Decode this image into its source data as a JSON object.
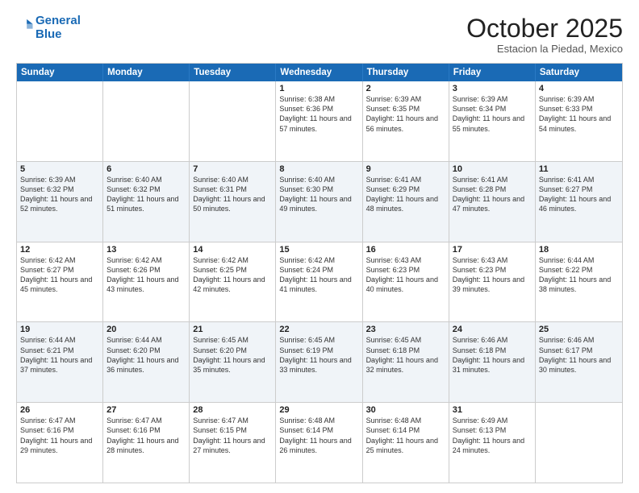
{
  "header": {
    "logo_line1": "General",
    "logo_line2": "Blue",
    "month": "October 2025",
    "location": "Estacion la Piedad, Mexico"
  },
  "days_of_week": [
    "Sunday",
    "Monday",
    "Tuesday",
    "Wednesday",
    "Thursday",
    "Friday",
    "Saturday"
  ],
  "weeks": [
    {
      "alt": false,
      "cells": [
        {
          "day": "",
          "text": ""
        },
        {
          "day": "",
          "text": ""
        },
        {
          "day": "",
          "text": ""
        },
        {
          "day": "1",
          "text": "Sunrise: 6:38 AM\nSunset: 6:36 PM\nDaylight: 11 hours and 57 minutes."
        },
        {
          "day": "2",
          "text": "Sunrise: 6:39 AM\nSunset: 6:35 PM\nDaylight: 11 hours and 56 minutes."
        },
        {
          "day": "3",
          "text": "Sunrise: 6:39 AM\nSunset: 6:34 PM\nDaylight: 11 hours and 55 minutes."
        },
        {
          "day": "4",
          "text": "Sunrise: 6:39 AM\nSunset: 6:33 PM\nDaylight: 11 hours and 54 minutes."
        }
      ]
    },
    {
      "alt": true,
      "cells": [
        {
          "day": "5",
          "text": "Sunrise: 6:39 AM\nSunset: 6:32 PM\nDaylight: 11 hours and 52 minutes."
        },
        {
          "day": "6",
          "text": "Sunrise: 6:40 AM\nSunset: 6:32 PM\nDaylight: 11 hours and 51 minutes."
        },
        {
          "day": "7",
          "text": "Sunrise: 6:40 AM\nSunset: 6:31 PM\nDaylight: 11 hours and 50 minutes."
        },
        {
          "day": "8",
          "text": "Sunrise: 6:40 AM\nSunset: 6:30 PM\nDaylight: 11 hours and 49 minutes."
        },
        {
          "day": "9",
          "text": "Sunrise: 6:41 AM\nSunset: 6:29 PM\nDaylight: 11 hours and 48 minutes."
        },
        {
          "day": "10",
          "text": "Sunrise: 6:41 AM\nSunset: 6:28 PM\nDaylight: 11 hours and 47 minutes."
        },
        {
          "day": "11",
          "text": "Sunrise: 6:41 AM\nSunset: 6:27 PM\nDaylight: 11 hours and 46 minutes."
        }
      ]
    },
    {
      "alt": false,
      "cells": [
        {
          "day": "12",
          "text": "Sunrise: 6:42 AM\nSunset: 6:27 PM\nDaylight: 11 hours and 45 minutes."
        },
        {
          "day": "13",
          "text": "Sunrise: 6:42 AM\nSunset: 6:26 PM\nDaylight: 11 hours and 43 minutes."
        },
        {
          "day": "14",
          "text": "Sunrise: 6:42 AM\nSunset: 6:25 PM\nDaylight: 11 hours and 42 minutes."
        },
        {
          "day": "15",
          "text": "Sunrise: 6:42 AM\nSunset: 6:24 PM\nDaylight: 11 hours and 41 minutes."
        },
        {
          "day": "16",
          "text": "Sunrise: 6:43 AM\nSunset: 6:23 PM\nDaylight: 11 hours and 40 minutes."
        },
        {
          "day": "17",
          "text": "Sunrise: 6:43 AM\nSunset: 6:23 PM\nDaylight: 11 hours and 39 minutes."
        },
        {
          "day": "18",
          "text": "Sunrise: 6:44 AM\nSunset: 6:22 PM\nDaylight: 11 hours and 38 minutes."
        }
      ]
    },
    {
      "alt": true,
      "cells": [
        {
          "day": "19",
          "text": "Sunrise: 6:44 AM\nSunset: 6:21 PM\nDaylight: 11 hours and 37 minutes."
        },
        {
          "day": "20",
          "text": "Sunrise: 6:44 AM\nSunset: 6:20 PM\nDaylight: 11 hours and 36 minutes."
        },
        {
          "day": "21",
          "text": "Sunrise: 6:45 AM\nSunset: 6:20 PM\nDaylight: 11 hours and 35 minutes."
        },
        {
          "day": "22",
          "text": "Sunrise: 6:45 AM\nSunset: 6:19 PM\nDaylight: 11 hours and 33 minutes."
        },
        {
          "day": "23",
          "text": "Sunrise: 6:45 AM\nSunset: 6:18 PM\nDaylight: 11 hours and 32 minutes."
        },
        {
          "day": "24",
          "text": "Sunrise: 6:46 AM\nSunset: 6:18 PM\nDaylight: 11 hours and 31 minutes."
        },
        {
          "day": "25",
          "text": "Sunrise: 6:46 AM\nSunset: 6:17 PM\nDaylight: 11 hours and 30 minutes."
        }
      ]
    },
    {
      "alt": false,
      "cells": [
        {
          "day": "26",
          "text": "Sunrise: 6:47 AM\nSunset: 6:16 PM\nDaylight: 11 hours and 29 minutes."
        },
        {
          "day": "27",
          "text": "Sunrise: 6:47 AM\nSunset: 6:16 PM\nDaylight: 11 hours and 28 minutes."
        },
        {
          "day": "28",
          "text": "Sunrise: 6:47 AM\nSunset: 6:15 PM\nDaylight: 11 hours and 27 minutes."
        },
        {
          "day": "29",
          "text": "Sunrise: 6:48 AM\nSunset: 6:14 PM\nDaylight: 11 hours and 26 minutes."
        },
        {
          "day": "30",
          "text": "Sunrise: 6:48 AM\nSunset: 6:14 PM\nDaylight: 11 hours and 25 minutes."
        },
        {
          "day": "31",
          "text": "Sunrise: 6:49 AM\nSunset: 6:13 PM\nDaylight: 11 hours and 24 minutes."
        },
        {
          "day": "",
          "text": ""
        }
      ]
    }
  ]
}
